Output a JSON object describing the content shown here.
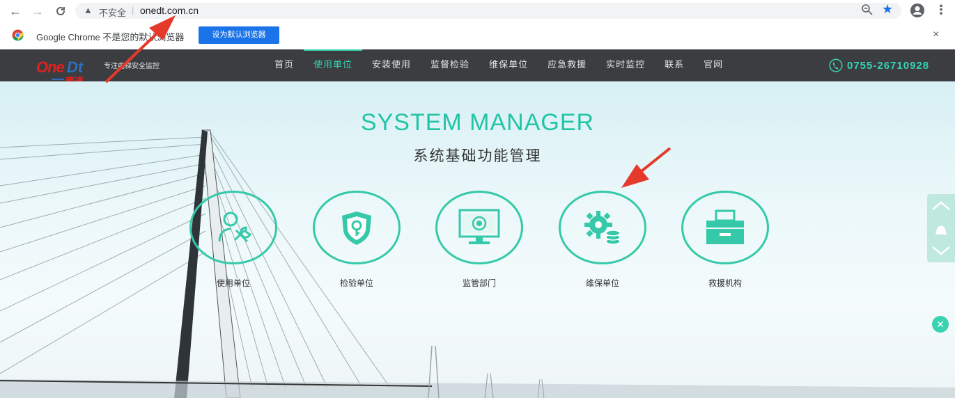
{
  "browser": {
    "security_label": "不安全",
    "separator": "|",
    "url": "onedt.com.cn"
  },
  "infobar": {
    "message": "Google Chrome 不是您的默认浏览器",
    "set_default_button": "设为默认浏览器",
    "close": "×"
  },
  "site": {
    "logo_one": "One",
    "logo_dt": "Dt",
    "logo_cn": "壹通",
    "slogan": "专注电梯安全监控",
    "menu": [
      "首页",
      "使用单位",
      "安装使用",
      "监督检验",
      "维保单位",
      "应急救援",
      "实时监控",
      "联系",
      "官网"
    ],
    "active_menu": "使用单位",
    "phone": "0755-26710928"
  },
  "hero": {
    "title": "SYSTEM MANAGER",
    "subtitle": "系统基础功能管理",
    "functions": [
      {
        "label": "使用单位",
        "icon": "user-wrench-icon"
      },
      {
        "label": "检验单位",
        "icon": "shield-key-icon"
      },
      {
        "label": "监管部门",
        "icon": "monitor-icon"
      },
      {
        "label": "维保单位",
        "icon": "gear-coins-icon"
      },
      {
        "label": "救援机构",
        "icon": "printer-box-icon"
      }
    ]
  },
  "colors": {
    "accent": "#35c9a9",
    "nav_bg": "#3b3d40",
    "annotation": "#e53a2b"
  }
}
